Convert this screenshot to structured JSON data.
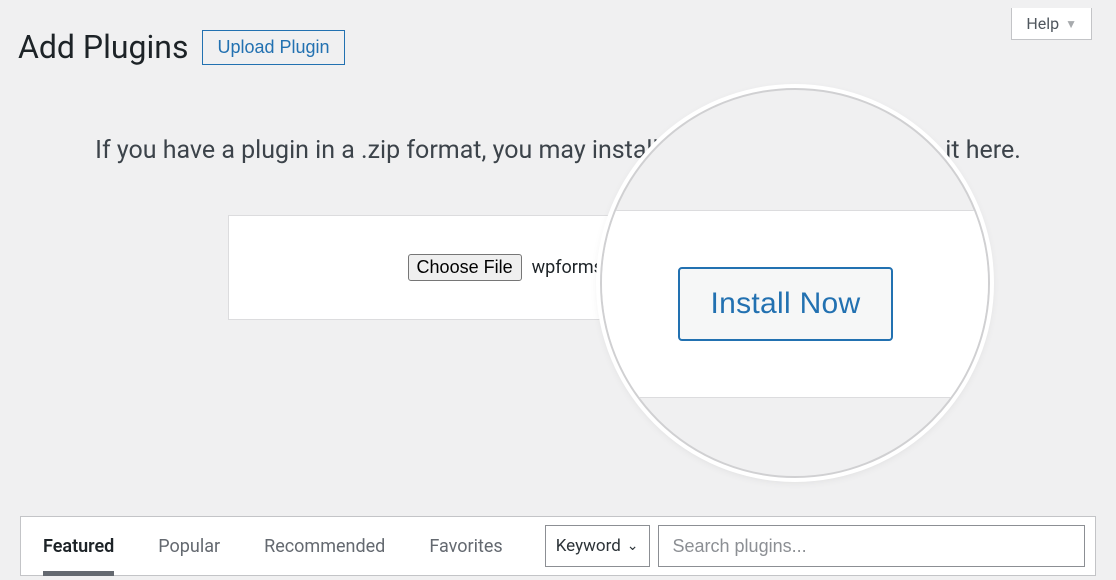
{
  "help": {
    "label": "Help"
  },
  "header": {
    "title": "Add Plugins",
    "upload_label": "Upload Plugin"
  },
  "instruction_text_full": "If you have a plugin in a .zip format, you may install or update it by uploading it here.",
  "upload": {
    "choose_file_label": "Choose File",
    "file_name": "wpforms-form…andon",
    "install_now_label": "Install Now"
  },
  "filter": {
    "tabs": [
      {
        "label": "Featured",
        "active": true
      },
      {
        "label": "Popular",
        "active": false
      },
      {
        "label": "Recommended",
        "active": false
      },
      {
        "label": "Favorites",
        "active": false
      }
    ],
    "keyword_label": "Keyword",
    "search_placeholder": "Search plugins..."
  }
}
